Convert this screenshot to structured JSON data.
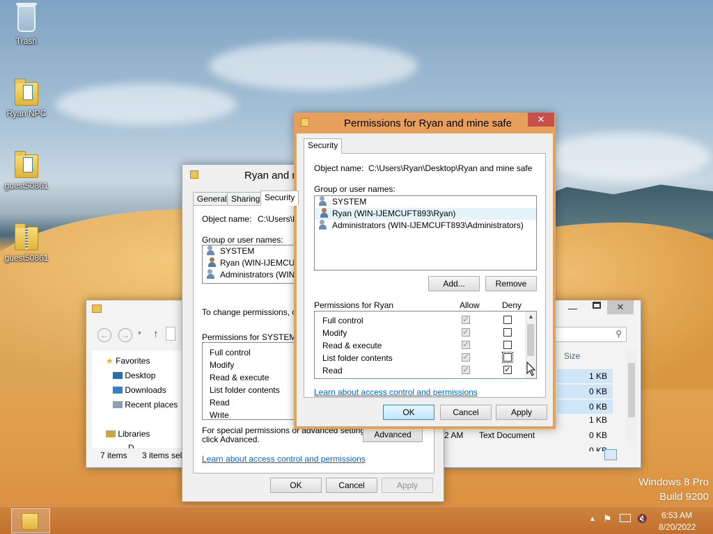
{
  "desktop": {
    "icons": [
      {
        "label": "Trash",
        "icon": "recycle-bin-icon"
      },
      {
        "label": "Ryan NPC",
        "icon": "folder-icon"
      },
      {
        "label": "guest50861",
        "icon": "folder-icon"
      },
      {
        "label": "guest50861",
        "icon": "zip-folder-icon"
      }
    ],
    "watermark": {
      "line1": "Windows 8 Pro",
      "line2": "Build 9200"
    }
  },
  "explorer": {
    "favorites": "Favorites",
    "nav": [
      "Desktop",
      "Downloads",
      "Recent places"
    ],
    "libraries": "Libraries",
    "libraries_next": "D",
    "status_items": "7 items",
    "status_selected": "3 items sele",
    "column_size": "Size",
    "sizes": [
      "1 KB",
      "0 KB",
      "0 KB",
      "1 KB",
      "0 KB",
      "0 KB"
    ],
    "partial_row": {
      "time": "2 AM",
      "type": "Text Document"
    }
  },
  "props": {
    "title": "Ryan and m",
    "tabs": [
      "General",
      "Sharing",
      "Security"
    ],
    "object_label": "Object name:",
    "object_value": "C:\\Users\\R",
    "group_label": "Group or user names:",
    "users": [
      "SYSTEM",
      "Ryan (WIN-IJEMCUFT",
      "Administrators (WIN-IJE"
    ],
    "change_text": "To change permissions, click",
    "perm_label": "Permissions for SYSTEM",
    "perms": [
      "Full control",
      "Modify",
      "Read & execute",
      "List folder contents",
      "Read",
      "Write"
    ],
    "special_text_1": "For special permissions or advanced settings,",
    "special_text_2": "click Advanced.",
    "advanced": "Advanced",
    "learn": "Learn about access control and permissions",
    "ok": "OK",
    "cancel": "Cancel",
    "apply": "Apply"
  },
  "perm_dialog": {
    "title": "Permissions for Ryan and mine safe",
    "tab": "Security",
    "object_label": "Object name:",
    "object_value": "C:\\Users\\Ryan\\Desktop\\Ryan and mine safe",
    "group_label": "Group or user names:",
    "users": [
      "SYSTEM",
      "Ryan (WIN-IJEMCUFT893\\Ryan)",
      "Administrators (WIN-IJEMCUFT893\\Administrators)"
    ],
    "add": "Add...",
    "remove": "Remove",
    "perm_label": "Permissions for Ryan",
    "allow": "Allow",
    "deny": "Deny",
    "perms": [
      "Full control",
      "Modify",
      "Read & execute",
      "List folder contents",
      "Read"
    ],
    "learn": "Learn about access control and permissions",
    "ok": "OK",
    "cancel": "Cancel",
    "apply": "Apply"
  },
  "taskbar": {
    "time": "6:53 AM",
    "date": "8/20/2022"
  }
}
